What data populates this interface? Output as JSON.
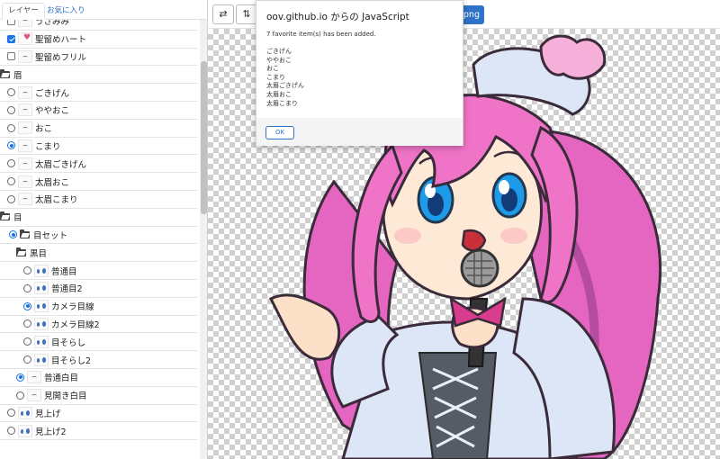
{
  "tabs": {
    "layers": "レイヤー",
    "favorites": "お気に入り"
  },
  "toolbar": {
    "save_png": "png"
  },
  "tree": [
    {
      "label": "うさみみ",
      "kind": "checkbox",
      "checked": false,
      "thumb": "plain"
    },
    {
      "label": "聖留めハート",
      "kind": "checkbox",
      "checked": true,
      "thumb": "heart"
    },
    {
      "label": "聖留めフリル",
      "kind": "checkbox",
      "checked": false,
      "thumb": "plain"
    },
    {
      "label": "眉",
      "kind": "folder"
    },
    {
      "label": "ごきげん",
      "kind": "radio",
      "checked": false,
      "thumb": "plain"
    },
    {
      "label": "ややおこ",
      "kind": "radio",
      "checked": false,
      "thumb": "plain"
    },
    {
      "label": "おこ",
      "kind": "radio",
      "checked": false,
      "thumb": "plain"
    },
    {
      "label": "こまり",
      "kind": "radio",
      "checked": true,
      "thumb": "plain"
    },
    {
      "label": "太眉ごきげん",
      "kind": "radio",
      "checked": false,
      "thumb": "plain"
    },
    {
      "label": "太眉おこ",
      "kind": "radio",
      "checked": false,
      "thumb": "plain"
    },
    {
      "label": "太眉こまり",
      "kind": "radio",
      "checked": false,
      "thumb": "plain"
    },
    {
      "label": "目",
      "kind": "folder"
    },
    {
      "label": "目セット",
      "kind": "radio-folder",
      "checked": true
    },
    {
      "label": "黒目",
      "kind": "folder"
    },
    {
      "label": "普通目",
      "kind": "radio",
      "checked": false,
      "thumb": "eye"
    },
    {
      "label": "普通目2",
      "kind": "radio",
      "checked": false,
      "thumb": "eye"
    },
    {
      "label": "カメラ目線",
      "kind": "radio",
      "checked": true,
      "thumb": "eye"
    },
    {
      "label": "カメラ目線2",
      "kind": "radio",
      "checked": false,
      "thumb": "eye"
    },
    {
      "label": "目そらし",
      "kind": "radio",
      "checked": false,
      "thumb": "eye"
    },
    {
      "label": "目そらし2",
      "kind": "radio",
      "checked": false,
      "thumb": "eye"
    },
    {
      "label": "普通白目",
      "kind": "radio",
      "checked": true,
      "thumb": "plain"
    },
    {
      "label": "見開き白目",
      "kind": "radio",
      "checked": false,
      "thumb": "plain"
    },
    {
      "label": "見上げ",
      "kind": "radio",
      "checked": false,
      "thumb": "eye"
    },
    {
      "label": "見上げ2",
      "kind": "radio",
      "checked": false,
      "thumb": "eye"
    }
  ],
  "dialog": {
    "title": "oov.github.io からの JavaScript",
    "message": "7 favorite item(s) has been added.",
    "items": [
      "ごきげん",
      "ややおこ",
      "おこ",
      "こまり",
      "太眉ごきげん",
      "太眉おこ",
      "太眉こまり"
    ],
    "ok_label": "OK"
  },
  "colors": {
    "accent": "#2e73c8",
    "checked": "#1a73e8",
    "hair": "#ee6fc6",
    "eye": "#1e9be8"
  }
}
